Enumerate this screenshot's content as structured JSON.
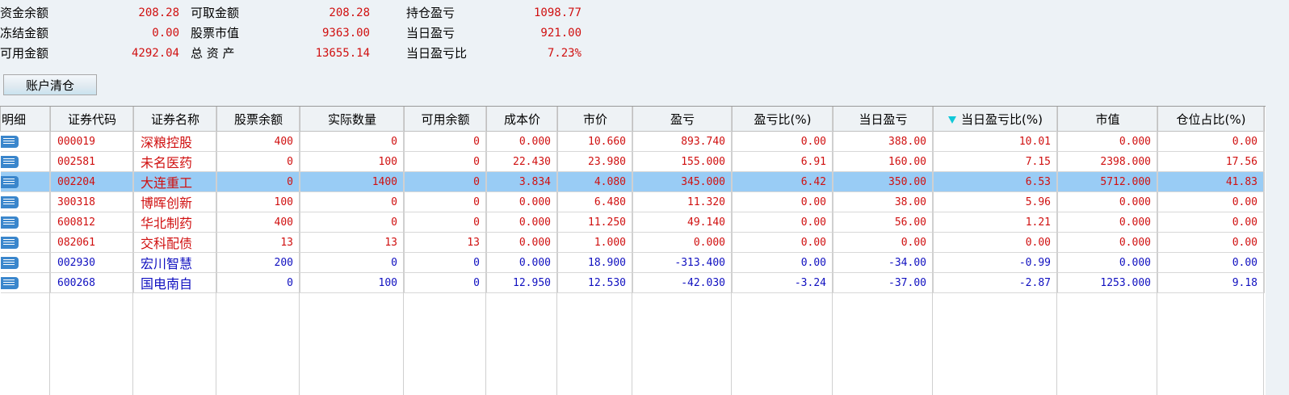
{
  "summary": {
    "rows": [
      [
        {
          "label": "资金余额",
          "value": "208.28"
        },
        {
          "label": "可取金额",
          "value": "208.28"
        },
        {
          "label": "持仓盈亏",
          "value": "1098.77"
        }
      ],
      [
        {
          "label": "冻结金额",
          "value": "0.00"
        },
        {
          "label": "股票市值",
          "value": "9363.00"
        },
        {
          "label": "当日盈亏",
          "value": "921.00"
        }
      ],
      [
        {
          "label": "可用金额",
          "value": "4292.04"
        },
        {
          "label": "总 资 产",
          "value": "13655.14"
        },
        {
          "label": "当日盈亏比",
          "value": "7.23%"
        }
      ]
    ]
  },
  "clear_button": "账户清仓",
  "table": {
    "columns": [
      "明细",
      "证券代码",
      "证券名称",
      "股票余额",
      "实际数量",
      "可用余额",
      "成本价",
      "市价",
      "盈亏",
      "盈亏比(%)",
      "当日盈亏",
      "当日盈亏比(%)",
      "市值",
      "仓位占比(%)"
    ],
    "sort_column": "当日盈亏比(%)",
    "rows": [
      {
        "color": "red",
        "cells": [
          "000019",
          "深粮控股",
          "400",
          "0",
          "0",
          "0.000",
          "10.660",
          "893.740",
          "0.00",
          "388.00",
          "10.01",
          "0.000",
          "0.00"
        ]
      },
      {
        "color": "red",
        "cells": [
          "002581",
          "未名医药",
          "0",
          "100",
          "0",
          "22.430",
          "23.980",
          "155.000",
          "6.91",
          "160.00",
          "7.15",
          "2398.000",
          "17.56"
        ]
      },
      {
        "color": "red",
        "selected": true,
        "cells": [
          "002204",
          "大连重工",
          "0",
          "1400",
          "0",
          "3.834",
          "4.080",
          "345.000",
          "6.42",
          "350.00",
          "6.53",
          "5712.000",
          "41.83"
        ]
      },
      {
        "color": "red",
        "cells": [
          "300318",
          "博晖创新",
          "100",
          "0",
          "0",
          "0.000",
          "6.480",
          "11.320",
          "0.00",
          "38.00",
          "5.96",
          "0.000",
          "0.00"
        ]
      },
      {
        "color": "red",
        "cells": [
          "600812",
          "华北制药",
          "400",
          "0",
          "0",
          "0.000",
          "11.250",
          "49.140",
          "0.00",
          "56.00",
          "1.21",
          "0.000",
          "0.00"
        ]
      },
      {
        "color": "red",
        "cells": [
          "082061",
          "交科配债",
          "13",
          "13",
          "13",
          "0.000",
          "1.000",
          "0.000",
          "0.00",
          "0.00",
          "0.00",
          "0.000",
          "0.00"
        ]
      },
      {
        "color": "blue",
        "cells": [
          "002930",
          "宏川智慧",
          "200",
          "0",
          "0",
          "0.000",
          "18.900",
          "-313.400",
          "0.00",
          "-34.00",
          "-0.99",
          "0.000",
          "0.00"
        ]
      },
      {
        "color": "blue",
        "cells": [
          "600268",
          "国电南自",
          "0",
          "100",
          "0",
          "12.950",
          "12.530",
          "-42.030",
          "-3.24",
          "-37.00",
          "-2.87",
          "1253.000",
          "9.18"
        ]
      }
    ]
  }
}
